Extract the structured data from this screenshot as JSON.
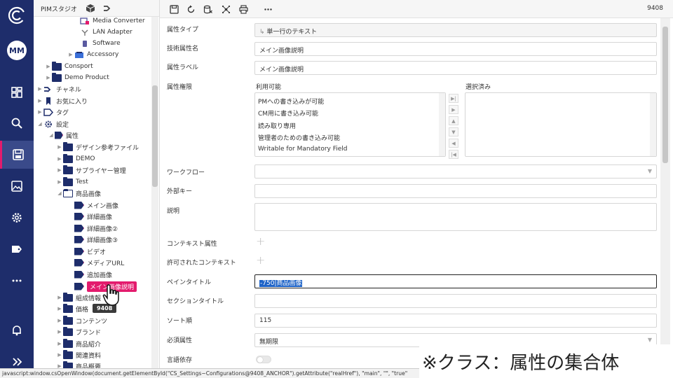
{
  "rail": {
    "avatar": "MM",
    "items": [
      {
        "icon": "dashboard-icon"
      },
      {
        "icon": "search-icon"
      },
      {
        "icon": "save-icon",
        "active": true
      },
      {
        "icon": "image-icon"
      },
      {
        "icon": "gear-icon"
      },
      {
        "icon": "tag-icon"
      },
      {
        "icon": "more-icon"
      },
      {
        "icon": "bell-icon"
      },
      {
        "icon": "expand-icon"
      }
    ]
  },
  "tree": {
    "title": "PIMスタジオ",
    "items": [
      {
        "label": "Media Converter"
      },
      {
        "label": "LAN Adapter"
      },
      {
        "label": "Software"
      },
      {
        "label": "Accessory"
      },
      {
        "label": "Consport"
      },
      {
        "label": "Demo Product"
      },
      {
        "label": "チャネル"
      },
      {
        "label": "お気に入り"
      },
      {
        "label": "タグ"
      },
      {
        "label": "設定"
      },
      {
        "label": "属性"
      },
      {
        "label": "デザイン参考ファイル"
      },
      {
        "label": "DEMO"
      },
      {
        "label": "サプライヤー管理"
      },
      {
        "label": "Test"
      },
      {
        "label": "商品画像"
      },
      {
        "label": "メイン画像"
      },
      {
        "label": "詳細画像"
      },
      {
        "label": "詳細画像②"
      },
      {
        "label": "詳細画像③"
      },
      {
        "label": "ビデオ"
      },
      {
        "label": "メディアURL"
      },
      {
        "label": "追加画像"
      },
      {
        "label": "メイン画像説明"
      },
      {
        "label": "組成情報"
      },
      {
        "label": "価格"
      },
      {
        "label": "コンテンツ"
      },
      {
        "label": "ブランド"
      },
      {
        "label": "商品紹介"
      },
      {
        "label": "関連資料"
      },
      {
        "label": "商品概要"
      }
    ],
    "tooltip": "9408"
  },
  "toolbar": {
    "record_id": "9408"
  },
  "form": {
    "attr_type_label": "属性タイプ",
    "attr_type_value": "単一行のテキスト",
    "tech_name_label": "技術属性名",
    "tech_name_value": "メイン画像説明",
    "attr_label_label": "属性ラベル",
    "attr_label_value": "メイン画像説明",
    "rights_label": "属性権限",
    "available_label": "利用可能",
    "selected_label": "選択済み",
    "available_items": [
      "PMへの書き込みが可能",
      "CM用に書き込み可能",
      "読み取り専用",
      "管理者のための書き込み可能",
      "Writable for Mandatory Field"
    ],
    "workflow_label": "ワークフロー",
    "workflow_value": "",
    "foreign_key_label": "外部キー",
    "foreign_key_value": "",
    "description_label": "説明",
    "description_value": "",
    "context_attr_label": "コンテキスト属性",
    "allowed_context_label": "許可されたコンテキスト",
    "pane_title_label": "ペインタイトル",
    "pane_title_value": "-750|商品画像",
    "section_title_label": "セクションタイトル",
    "section_title_value": "",
    "sort_order_label": "ソート順",
    "sort_order_value": "115",
    "required_label": "必須属性",
    "required_value": "無期限",
    "language_dep_label": "言語依存"
  },
  "statusbar": "javascript:window.csOpenWindow(document.getElementById(\"CS_Settings~Configurations@9408_ANCHOR\").getAttribute(\"realHref\"), \"main\", \"\", \"true\"",
  "caption": "※クラス：属性の集合体"
}
